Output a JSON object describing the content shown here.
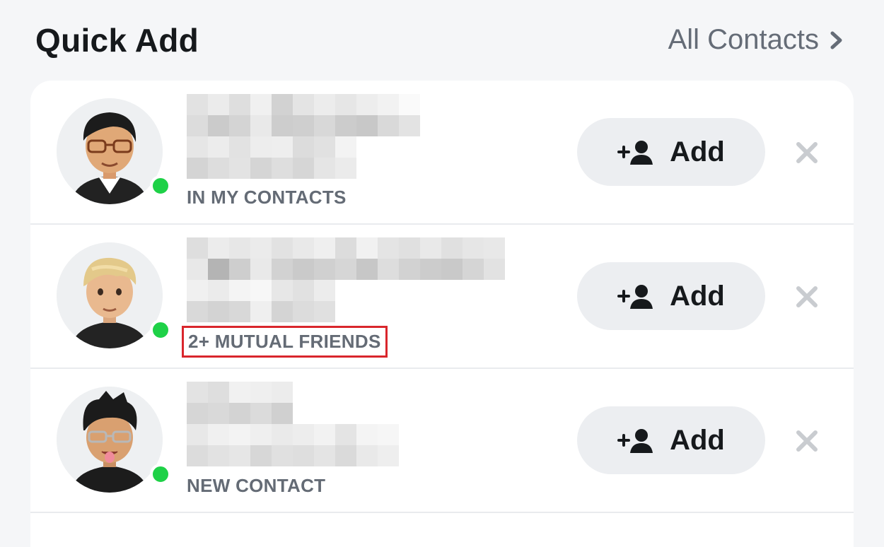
{
  "header": {
    "title": "Quick Add",
    "all_contacts_label": "All Contacts"
  },
  "suggestions": [
    {
      "reason": "IN MY CONTACTS",
      "add_label": "Add",
      "online": true,
      "highlighted": false
    },
    {
      "reason": "2+ MUTUAL FRIENDS",
      "add_label": "Add",
      "online": true,
      "highlighted": true
    },
    {
      "reason": "NEW CONTACT",
      "add_label": "Add",
      "online": true,
      "highlighted": false
    }
  ],
  "colors": {
    "online": "#1ed147",
    "highlight_border": "#d9262c",
    "button_bg": "#eceef1",
    "subtext": "#646b75"
  },
  "icons": {
    "all_contacts": "chevron-right-icon",
    "add": "add-friend-icon",
    "dismiss": "close-icon"
  }
}
